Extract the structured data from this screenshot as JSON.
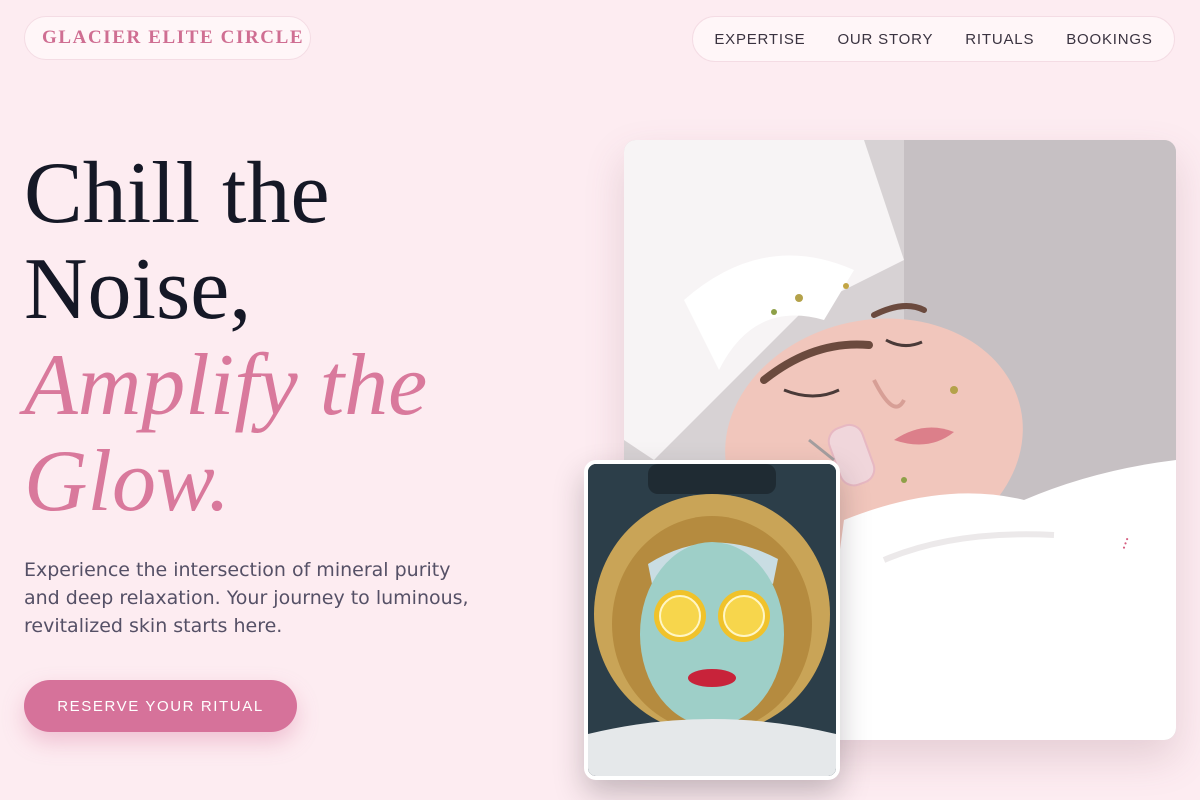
{
  "brand": {
    "name": "GLACIER ELITE CIRCLE"
  },
  "nav": {
    "items": [
      {
        "label": "EXPERTISE"
      },
      {
        "label": "OUR STORY"
      },
      {
        "label": "RITUALS"
      },
      {
        "label": "BOOKINGS"
      }
    ]
  },
  "hero": {
    "headline_line1": "Chill the",
    "headline_line2": "Noise,",
    "headline_accent1": "Amplify the",
    "headline_accent2": "Glow.",
    "description": "Experience the intersection of mineral purity and deep relaxation. Your journey to luminous, revitalized skin starts here.",
    "cta_label": "RESERVE YOUR RITUAL"
  },
  "images": {
    "main_photo": "woman-facial-treatment-photo",
    "secondary_photo": "face-mask-lemon-slices-photo"
  },
  "colors": {
    "background": "#fdecf1",
    "accent": "#d9799c",
    "cta": "#d6729a",
    "headline": "#151826",
    "body_text": "#555066"
  }
}
